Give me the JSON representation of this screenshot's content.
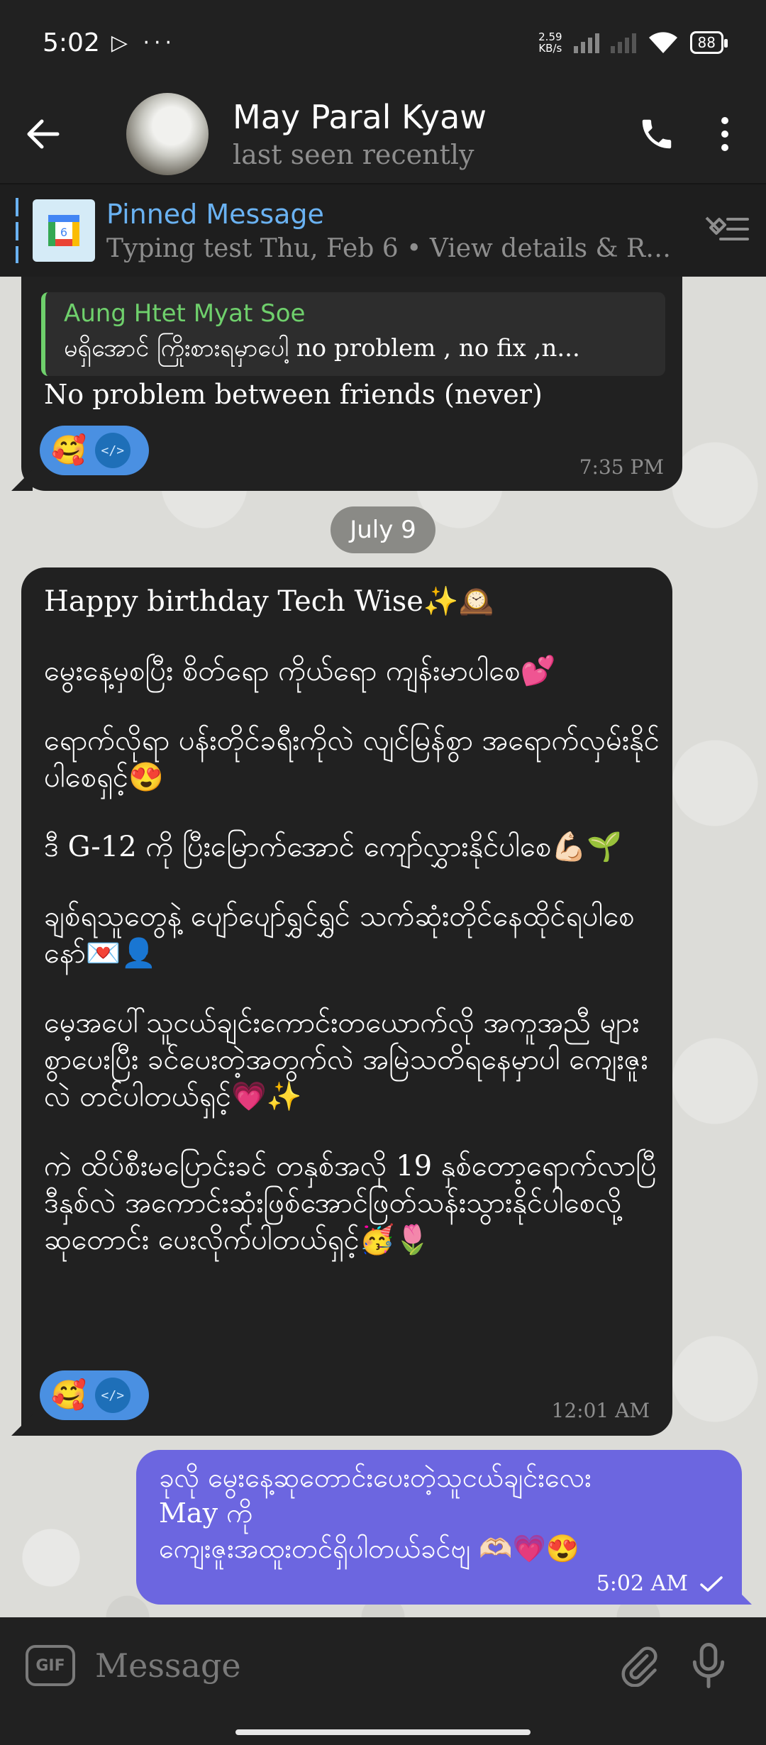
{
  "status_bar": {
    "time": "5:02",
    "extra_icons": "▷ ···",
    "net_speed_value": "2.59",
    "net_speed_unit": "KB/s",
    "battery": "88"
  },
  "header": {
    "contact_name": "May Paral Kyaw",
    "contact_status": "last seen recently"
  },
  "pinned": {
    "title": "Pinned Message",
    "text": "Typing test Thu, Feb 6 • View details & RSV..."
  },
  "messages": {
    "m1": {
      "reply_name": "Aung Htet Myat Soe",
      "reply_text": "မရှိအောင် ကြိုးစားရမှာပေါ့ no problem  , no fix ,n...",
      "text": "No problem between friends (never)",
      "reaction_emoji": "🥰",
      "reaction_code": "</>",
      "time": "7:35 PM"
    },
    "date_divider": "July 9",
    "m2": {
      "p1": "Happy birthday Tech Wise✨🕰️",
      "p2": "မွေးနေ့မှစပြီး စိတ်ရော ကိုယ်ရော ကျန်းမာပါစေ💕",
      "p3": "ရောက်လိုရာ ပန်းတိုင်ခရီးကိုလဲ လျင်မြန်စွာ အရောက်လှမ်းနိုင်ပါစေရှင့်😍",
      "p4": "ဒီ G-12 ကို ပြီးမြောက်အောင် ကျော်လွှားနိုင်ပါစေ💪🏻🌱",
      "p5": "ချစ်ရသူတွေနဲ့ ပျော်ပျော်ရွှင်ရွှင် သက်ဆုံးတိုင်နေထိုင်ရပါစေ နော်💌👤",
      "p6": "မေ့အပေါ်သူငယ်ချင်းကောင်းတယောက်လို အကူအညီ များစွာပေးပြီး ခင်ပေးတဲ့အတွက်လဲ အမြဲသတိရနေမှာပါ ကျေးဇူးလဲ တင်ပါတယ်ရှင့်💗✨",
      "p7": "ကဲ ထိပ်စီးမပြောင်းခင် တနှစ်အလို 19 နှစ်တော့ရောက်လာပြီ ဒီနှစ်လဲ အကောင်းဆုံးဖြစ်အောင်ဖြတ်သန်းသွားနိုင်ပါစေလို့ ဆုတောင်း ပေးလိုက်ပါတယ်ရှင့်🥳🌷",
      "reaction_emoji": "🥰",
      "reaction_code": "</>",
      "time": "12:01 AM"
    },
    "m3": {
      "line1": "ခုလို မွေးနေ့ဆုတောင်းပေးတဲ့သူငယ်ချင်းလေး",
      "line2": "May ကို",
      "line3": "ကျေးဇူးအထူးတင်ရှိပါတယ်ခင်ဗျ 🫶🏻💗😍",
      "time": "5:02 AM"
    }
  },
  "input": {
    "gif_label": "GIF",
    "placeholder": "Message"
  },
  "colors": {
    "accent": "#6ab2f2",
    "outgoing_bubble": "#6c66e0",
    "reply_name": "#6fd06c",
    "reaction": "#4a90e2"
  }
}
